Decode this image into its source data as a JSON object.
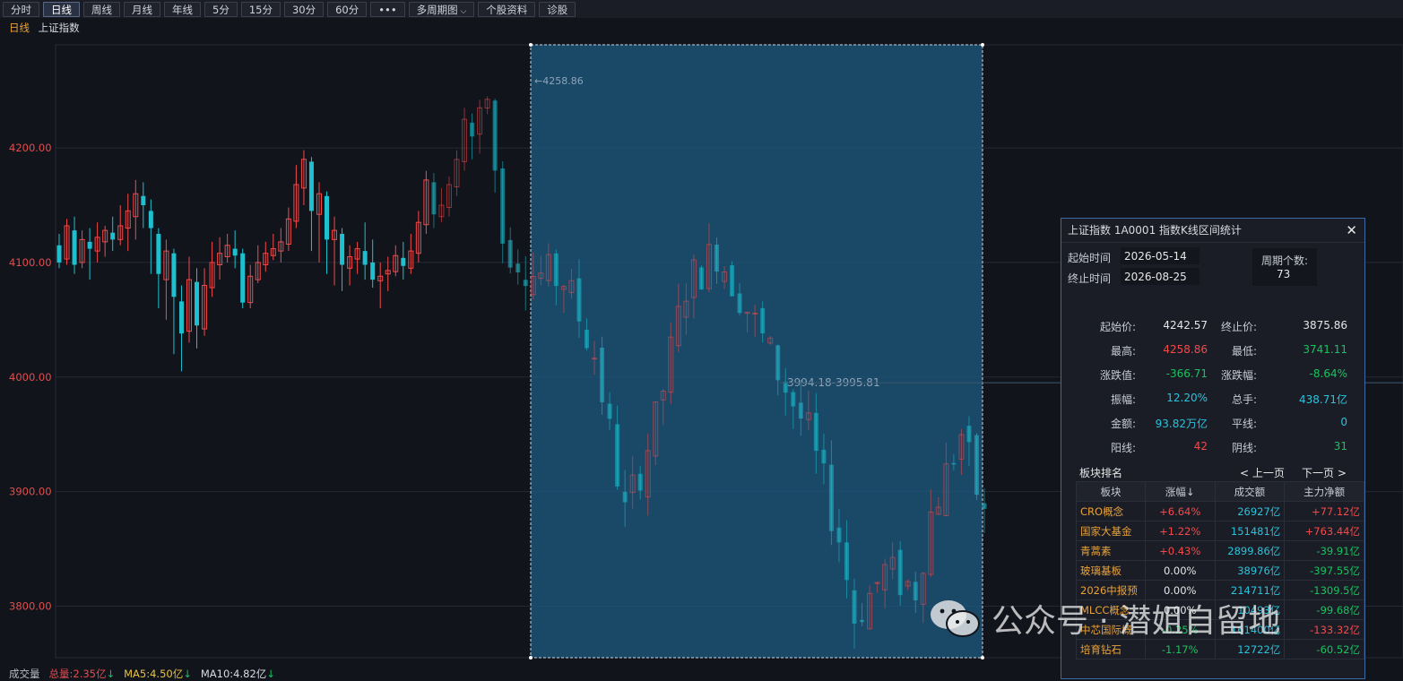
{
  "toolbar": {
    "items": [
      {
        "label": "分时",
        "active": false,
        "arrow": false
      },
      {
        "label": "日线",
        "active": true,
        "arrow": false
      },
      {
        "label": "周线",
        "active": false,
        "arrow": false
      },
      {
        "label": "月线",
        "active": false,
        "arrow": false
      },
      {
        "label": "年线",
        "active": false,
        "arrow": false
      },
      {
        "label": "5分",
        "active": false,
        "arrow": false
      },
      {
        "label": "15分",
        "active": false,
        "arrow": false
      },
      {
        "label": "30分",
        "active": false,
        "arrow": false
      },
      {
        "label": "60分",
        "active": false,
        "arrow": false
      },
      {
        "label": "•••",
        "active": false,
        "arrow": false
      },
      {
        "label": "多周期图",
        "active": false,
        "arrow": true
      },
      {
        "label": "个股资料",
        "active": false,
        "arrow": false
      },
      {
        "label": "诊股",
        "active": false,
        "arrow": false
      }
    ]
  },
  "header": {
    "period": "日线",
    "name": "上证指数"
  },
  "chart_data": {
    "type": "candlestick",
    "ylim": [
      3755,
      4290
    ],
    "yticks": [
      "4200.00",
      "4100.00",
      "4000.00",
      "3900.00",
      "3800.00"
    ],
    "ytick_values": [
      4200,
      4100,
      4000,
      3900,
      3800
    ],
    "selection": {
      "start_index": 49,
      "end_index": 121
    },
    "annotations": {
      "high": "4258.86",
      "mid": "3994.18-3995.81",
      "low": "3741.11"
    },
    "colors": {
      "up": "#f24a4a",
      "down": "#1ec0cf",
      "selection": "#1e5a80"
    },
    "candles": [
      [
        4115,
        4100,
        4125,
        4095
      ],
      [
        4103,
        4132,
        4138,
        4098
      ],
      [
        4128,
        4098,
        4140,
        4090
      ],
      [
        4100,
        4120,
        4128,
        4095
      ],
      [
        4118,
        4112,
        4130,
        4085
      ],
      [
        4110,
        4122,
        4135,
        4100
      ],
      [
        4118,
        4128,
        4132,
        4105
      ],
      [
        4126,
        4120,
        4140,
        4110
      ],
      [
        4120,
        4132,
        4150,
        4115
      ],
      [
        4130,
        4145,
        4160,
        4110
      ],
      [
        4140,
        4160,
        4172,
        4120
      ],
      [
        4158,
        4150,
        4170,
        4130
      ],
      [
        4145,
        4130,
        4155,
        4090
      ],
      [
        4125,
        4090,
        4130,
        4060
      ],
      [
        4085,
        4110,
        4120,
        4050
      ],
      [
        4108,
        4070,
        4112,
        4020
      ],
      [
        4066,
        4038,
        4080,
        4005
      ],
      [
        4040,
        4085,
        4105,
        4030
      ],
      [
        4083,
        4045,
        4095,
        4025
      ],
      [
        4042,
        4080,
        4095,
        4036
      ],
      [
        4078,
        4100,
        4118,
        4070
      ],
      [
        4098,
        4108,
        4122,
        4085
      ],
      [
        4105,
        4115,
        4125,
        4100
      ],
      [
        4112,
        4106,
        4128,
        4095
      ],
      [
        4108,
        4065,
        4112,
        4060
      ],
      [
        4065,
        4088,
        4098,
        4060
      ],
      [
        4085,
        4100,
        4115,
        4082
      ],
      [
        4098,
        4108,
        4118,
        4092
      ],
      [
        4106,
        4112,
        4125,
        4102
      ],
      [
        4110,
        4118,
        4130,
        4100
      ],
      [
        4116,
        4138,
        4148,
        4110
      ],
      [
        4136,
        4168,
        4185,
        4130
      ],
      [
        4165,
        4190,
        4198,
        4150
      ],
      [
        4188,
        4145,
        4192,
        4110
      ],
      [
        4142,
        4160,
        4170,
        4100
      ],
      [
        4158,
        4120,
        4162,
        4090
      ],
      [
        4120,
        4128,
        4140,
        4080
      ],
      [
        4125,
        4098,
        4130,
        4075
      ],
      [
        4095,
        4105,
        4115,
        4080
      ],
      [
        4103,
        4112,
        4118,
        4090
      ],
      [
        4110,
        4098,
        4135,
        4085
      ],
      [
        4100,
        4085,
        4120,
        4078
      ],
      [
        4084,
        4088,
        4100,
        4060
      ],
      [
        4090,
        4093,
        4105,
        4075
      ],
      [
        4092,
        4106,
        4115,
        4088
      ],
      [
        4104,
        4097,
        4118,
        4085
      ],
      [
        4095,
        4110,
        4125,
        4090
      ],
      [
        4108,
        4135,
        4145,
        4100
      ],
      [
        4133,
        4172,
        4180,
        4125
      ],
      [
        4170,
        4142,
        4178,
        4130
      ],
      [
        4140,
        4150,
        4165,
        4135
      ],
      [
        4148,
        4168,
        4175,
        4140
      ],
      [
        4166,
        4190,
        4198,
        4158
      ],
      [
        4188,
        4225,
        4235,
        4180
      ],
      [
        4222,
        4210,
        4230,
        4190
      ],
      [
        4212,
        4235,
        4242,
        4195
      ]
    ]
  },
  "panel": {
    "title": "上证指数  1A0001  指数K线区间统计",
    "start_time_label": "起始时间",
    "start_time": "2026-05-14",
    "end_time_label": "终止时间",
    "end_time": "2026-08-25",
    "period_count_label": "周期个数:",
    "period_count": "73",
    "stats": [
      {
        "l1": "起始价:",
        "v1": "4242.57",
        "c1": "white",
        "l2": "终止价:",
        "v2": "3875.86",
        "c2": "white"
      },
      {
        "l1": "最高:",
        "v1": "4258.86",
        "c1": "red",
        "l2": "最低:",
        "v2": "3741.11",
        "c2": "grn"
      },
      {
        "l1": "涨跌值:",
        "v1": "-366.71",
        "c1": "grn",
        "l2": "涨跌幅:",
        "v2": "-8.64%",
        "c2": "grn"
      },
      {
        "l1": "振幅:",
        "v1": "12.20%",
        "c1": "cyan",
        "l2": "总手:",
        "v2": "438.71亿",
        "c2": "cyan"
      },
      {
        "l1": "金额:",
        "v1": "93.82万亿",
        "c1": "cyan",
        "l2": "平线:",
        "v2": "0",
        "c2": "cyan"
      },
      {
        "l1": "阳线:",
        "v1": "42",
        "c1": "red",
        "l2": "阴线:",
        "v2": "31",
        "c2": "grn"
      }
    ],
    "sector_rank_label": "板块排名",
    "prev_page": "< 上一页",
    "next_page": "下一页 >",
    "table_headers": [
      "板块",
      "涨幅↓",
      "成交额",
      "主力净额"
    ],
    "table_rows": [
      {
        "name": "CRO概念",
        "chg": "+6.64%",
        "chg_c": "red",
        "amt": "26927亿",
        "net": "+77.12亿",
        "net_c": "red"
      },
      {
        "name": "国家大基金",
        "chg": "+1.22%",
        "chg_c": "red",
        "amt": "151481亿",
        "net": "+763.44亿",
        "net_c": "red"
      },
      {
        "name": "青蒿素",
        "chg": "+0.43%",
        "chg_c": "red",
        "amt": "2899.86亿",
        "net": "-39.91亿",
        "net_c": "grn"
      },
      {
        "name": "玻璃基板",
        "chg": "0.00%",
        "chg_c": "white",
        "amt": "38976亿",
        "net": "-397.55亿",
        "net_c": "grn"
      },
      {
        "name": "2026中报预",
        "chg": "0.00%",
        "chg_c": "white",
        "amt": "214711亿",
        "net": "-1309.5亿",
        "net_c": "grn"
      },
      {
        "name": "MLCC概念",
        "chg": "0.00%",
        "chg_c": "white",
        "amt": "10493亿",
        "net": "-99.68亿",
        "net_c": "grn"
      },
      {
        "name": "中芯国际概",
        "chg": "-0.25%",
        "chg_c": "grn",
        "amt": "161400亿",
        "net": "-133.32亿",
        "net_c": "red"
      },
      {
        "name": "培育钻石",
        "chg": "-1.17%",
        "chg_c": "grn",
        "amt": "12722亿",
        "net": "-60.52亿",
        "net_c": "grn"
      }
    ]
  },
  "bottom": {
    "volume_label": "成交量",
    "total": "总量:2.35亿",
    "ma5": "MA5:4.50亿",
    "ma10": "MA10:4.82亿"
  },
  "watermark": {
    "text": "公众号 · 潜姐自留地"
  }
}
